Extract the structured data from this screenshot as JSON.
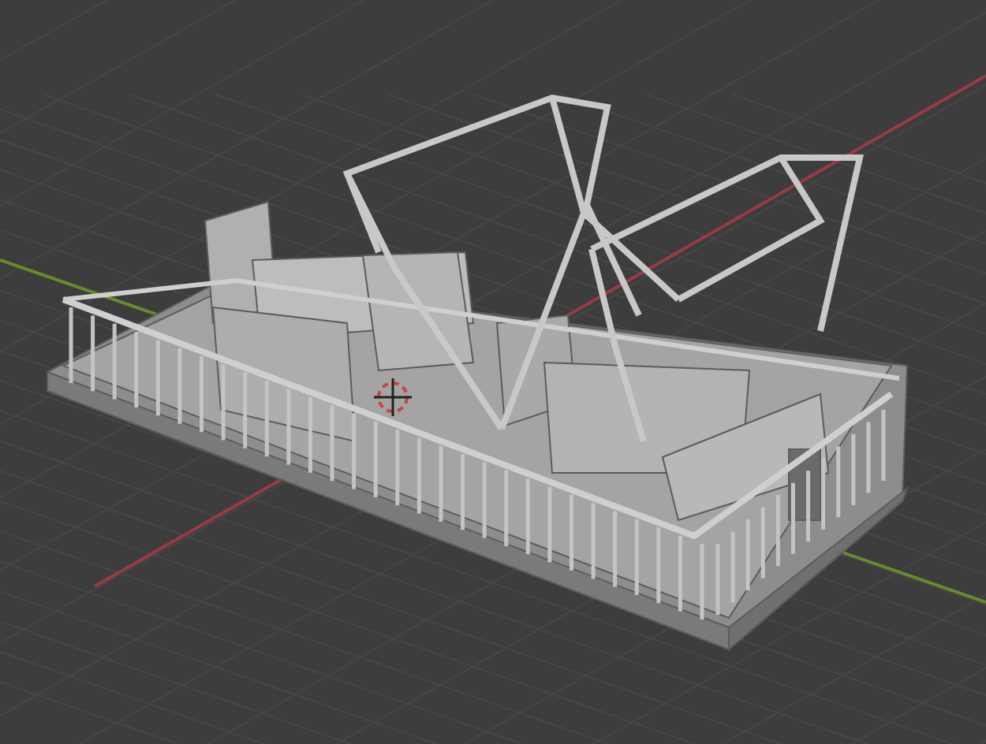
{
  "viewport": {
    "axes": [
      {
        "kind": "x",
        "color": "#9a3a44"
      },
      {
        "kind": "y",
        "color": "#6a8a2c"
      }
    ]
  }
}
